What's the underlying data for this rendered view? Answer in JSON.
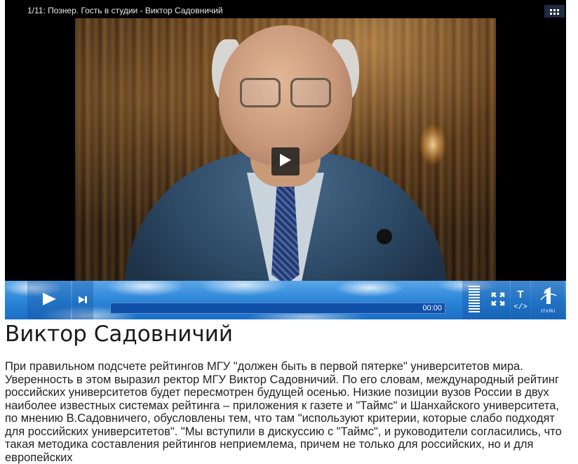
{
  "player": {
    "video_title": "1/11: Познер. Гость в студии - Виктор Садовничий",
    "time": "00:00",
    "logo_text": "1TV.RU",
    "text_button": "T",
    "embed_button": "</>"
  },
  "article": {
    "heading": "Виктор Садовничий",
    "body": "При правильном подсчете рейтингов МГУ \"должен быть в первой пятерке\" университетов мира. Уверенность в этом выразил ректор МГУ Виктор Садовничий. По его словам, международный рейтинг российских университетов будет пересмотрен будущей осенью. Низкие позиции вузов России в двух наиболее известных системах рейтинга – приложения к газете и \"Таймс\" и Шанхайского университета, по мнению В.Садовничего, обусловлены тем, что там \"используют критерии, которые слабо подходят для российских университетов\". \"Мы вступили в дискуссию с \"Таймс\", и руководители согласились, что  такая методика составления  рейтингов неприемлема, причем не только для российских, но и для европейских"
  },
  "icons": {
    "grid": "grid-icon",
    "play_overlay": "play-icon",
    "play": "play-icon",
    "next": "next-track-icon",
    "volume": "volume-bars-icon",
    "fullscreen": "fullscreen-icon",
    "channel_logo": "channel-one-logo"
  },
  "colors": {
    "control_bar": "#2c86d8",
    "progress_track": "#0f4fa8"
  }
}
